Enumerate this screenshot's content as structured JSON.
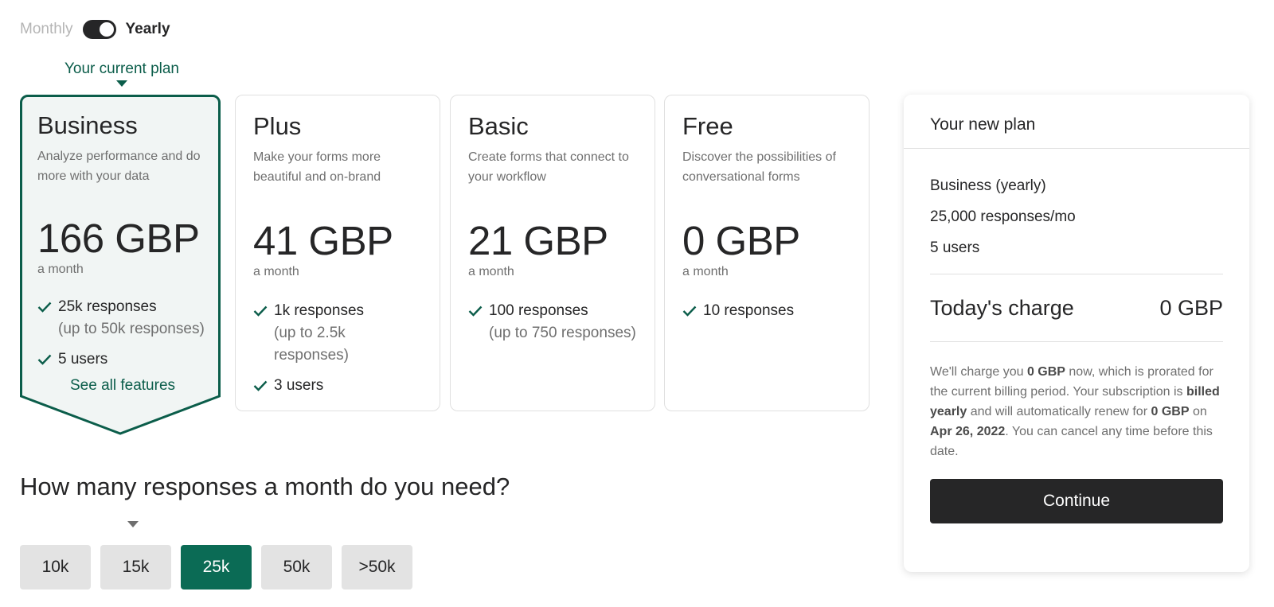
{
  "billing": {
    "monthly_label": "Monthly",
    "yearly_label": "Yearly",
    "selected": "Yearly"
  },
  "current_plan_label": "Your current plan",
  "plans": [
    {
      "name": "Business",
      "description": "Analyze performance and do more with your data",
      "price": "166 GBP",
      "period": "a month",
      "features": [
        {
          "text": "25k responses",
          "sub": "(up to 50k responses)"
        },
        {
          "text": "5 users",
          "sub": ""
        }
      ],
      "see_all": "See all features"
    },
    {
      "name": "Plus",
      "description": "Make your forms more beautiful and on-brand",
      "price": "41 GBP",
      "period": "a month",
      "features": [
        {
          "text": "1k responses",
          "sub": "(up to 2.5k responses)"
        },
        {
          "text": "3 users",
          "sub": ""
        }
      ]
    },
    {
      "name": "Basic",
      "description": "Create forms that connect to your workflow",
      "price": "21 GBP",
      "period": "a month",
      "features": [
        {
          "text": "100 responses",
          "sub": "(up to 750 responses)"
        }
      ]
    },
    {
      "name": "Free",
      "description": "Discover the possibilities of conversational forms",
      "price": "0 GBP",
      "period": "a month",
      "features": [
        {
          "text": "10 responses",
          "sub": ""
        }
      ]
    }
  ],
  "responses": {
    "title": "How many responses a month do you need?",
    "options": [
      "10k",
      "15k",
      "25k",
      "50k",
      ">50k"
    ],
    "selected": "25k"
  },
  "summary": {
    "title": "Your new plan",
    "lines": [
      "Business (yearly)",
      "25,000 responses/mo",
      "5 users"
    ],
    "charge_label": "Today's charge",
    "charge_value": "0 GBP",
    "note": {
      "p1": "We'll charge you ",
      "amount_now": "0 GBP",
      "p2": " now, which is prorated for the current billing period. Your subscription is ",
      "billing": "billed yearly",
      "p3": " and will automatically renew for ",
      "amount_renew": "0 GBP",
      "p4": " on ",
      "date": "Apr 26, 2022",
      "p5": ". You can cancel any time before this date."
    },
    "continue_label": "Continue"
  },
  "colors": {
    "accent": "#0b5d4a",
    "selected_button": "#0b6b55",
    "dark": "#262627",
    "muted": "#6f6f6f"
  },
  "icons": {
    "feature": "check-icon"
  }
}
